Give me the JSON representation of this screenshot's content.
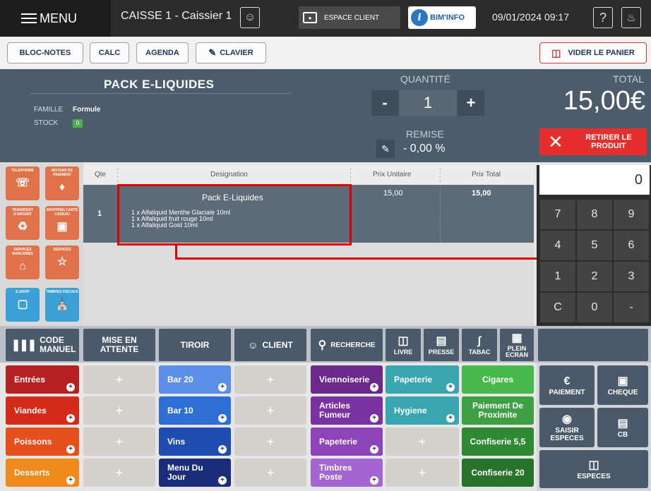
{
  "topbar": {
    "menu_label": "MENU",
    "caisse_label": "CAISSE 1 - Caissier 1",
    "espace_client_label": "ESPACE CLIENT",
    "bim_label": "BIM'INFO",
    "datetime": "09/01/2024 09:17"
  },
  "toolbar": {
    "bloc_notes": "BLOC-NOTES",
    "calc": "CALC",
    "agenda": "AGENDA",
    "clavier": "CLAVIER",
    "vider": "VIDER LE PANIER"
  },
  "product": {
    "name": "PACK E-LIQUIDES",
    "famille_label": "FAMILLE",
    "famille_value": "Formule",
    "stock_label": "STOCK",
    "stock_value": "0",
    "quantite_label": "QUANTITÉ",
    "quantite_value": "1",
    "minus": "-",
    "plus": "+",
    "remise_label": "REMISE",
    "remise_value": "- 0,00 %",
    "total_label": "TOTAL",
    "total_value": "15,00€",
    "retirer_label": "RETIRER LE PRODUIT"
  },
  "shortcuts": [
    {
      "label": "TELEPHONIE",
      "color": "#e0724a"
    },
    {
      "label": "MOYENS DE PAIEMENT",
      "color": "#e0724a"
    },
    {
      "label": "TRANSFERT D'ARGENT",
      "color": "#e0724a"
    },
    {
      "label": "SHOPPING CARTE CADEAU",
      "color": "#e0724a"
    },
    {
      "label": "SERVICES BANCAIRES",
      "color": "#e0724a"
    },
    {
      "label": "SERVICES",
      "color": "#e0724a"
    },
    {
      "label": "E-SHOP",
      "color": "#3aa0d6"
    },
    {
      "label": "TIMBRES FISCAUX",
      "color": "#3aa0d6"
    }
  ],
  "ticket": {
    "headers": {
      "qte": "Qte",
      "designation": "Designation",
      "prix_unitaire": "Prix Unitaire",
      "prix_total": "Prix Total"
    },
    "rows": [
      {
        "qte": "1",
        "name": "Pack E-Liquides",
        "lines": [
          "1 x Alfaliquid Menthe Glaciale 10ml",
          "1 x Alfaliquid fruit rouge 10ml",
          "1 x Alfaliquid Gold 10ml"
        ],
        "prix_unitaire": "15,00",
        "prix_total": "15,00"
      }
    ]
  },
  "keypad": {
    "display": "0",
    "keys": [
      "7",
      "8",
      "9",
      "4",
      "5",
      "6",
      "1",
      "2",
      "3",
      "C",
      "0",
      "-"
    ]
  },
  "funcbar": {
    "code_manuel": "CODE MANUEL",
    "mise_en_attente": "MISE EN ATTENTE",
    "tiroir": "TIROIR",
    "client": "CLIENT",
    "recherche": "RECHERCHE",
    "livre": "LIVRE",
    "presse": "PRESSE",
    "tabac": "TABAC",
    "plein_ecran": "PLEIN ECRAN"
  },
  "categories": {
    "col1": [
      {
        "label": "Entrées",
        "color": "#b52020"
      },
      {
        "label": "Viandes",
        "color": "#d42a1a"
      },
      {
        "label": "Poissons",
        "color": "#e5501c"
      },
      {
        "label": "Desserts",
        "color": "#ef8a1c"
      }
    ],
    "col3": [
      {
        "label": "Bar 20",
        "color": "#5b8fe8"
      },
      {
        "label": "Bar 10",
        "color": "#2e6fd6"
      },
      {
        "label": "Vins",
        "color": "#1e4db0"
      },
      {
        "label": "Menu Du Jour",
        "color": "#1a2c7a"
      }
    ],
    "col5": [
      {
        "label": "Viennoiserie",
        "color": "#6a2a8c"
      },
      {
        "label": "Articles Fumeur",
        "color": "#7a32a0"
      },
      {
        "label": "Papeterie",
        "color": "#8c44b8"
      },
      {
        "label": "Timbres Poste",
        "color": "#a366d0"
      }
    ],
    "col6": [
      {
        "label": "Papeterie",
        "color": "#3aa6b0"
      },
      {
        "label": "Hygiene",
        "color": "#3aa6b0"
      }
    ],
    "col7": [
      {
        "label": "Cigares",
        "color": "#49b84c"
      },
      {
        "label": "Paiement De Proximite",
        "color": "#3ea042"
      },
      {
        "label": "Confiserie 5,5",
        "color": "#2f8a33"
      },
      {
        "label": "Confiserie 20",
        "color": "#27732b"
      }
    ],
    "plus_symbol": "+"
  },
  "payment": {
    "paiement": "PAIEMENT",
    "cheque": "CHEQUE",
    "saisir_especes": "SAISIR ESPECES",
    "cb": "CB",
    "especes": "ESPECES"
  }
}
